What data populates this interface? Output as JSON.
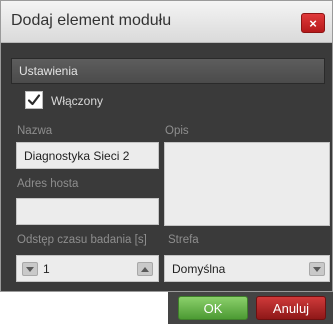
{
  "dialog": {
    "title": "Dodaj element modułu",
    "close_glyph": "×"
  },
  "section": {
    "label": "Ustawienia"
  },
  "enabled": {
    "label": "Włączony",
    "checked": true
  },
  "fields": {
    "name_label": "Nazwa",
    "name_value": "Diagnostyka Sieci 2",
    "description_label": "Opis",
    "description_value": "",
    "host_label": "Adres hosta",
    "host_value": "",
    "interval_label": "Odstęp czasu badania [s]",
    "interval_value": "1",
    "zone_label": "Strefa",
    "zone_value": "Domyślna"
  },
  "buttons": {
    "ok_label": "OK",
    "cancel_label": "Anuluj"
  },
  "colors": {
    "ok": "#5cae3f",
    "cancel": "#b52222",
    "close": "#cc2a2b"
  },
  "icons": {
    "close": "close-icon",
    "check": "checkmark-icon",
    "decrement": "triangle-down-icon",
    "increment": "triangle-up-icon",
    "dropdown": "chevron-down-icon"
  }
}
